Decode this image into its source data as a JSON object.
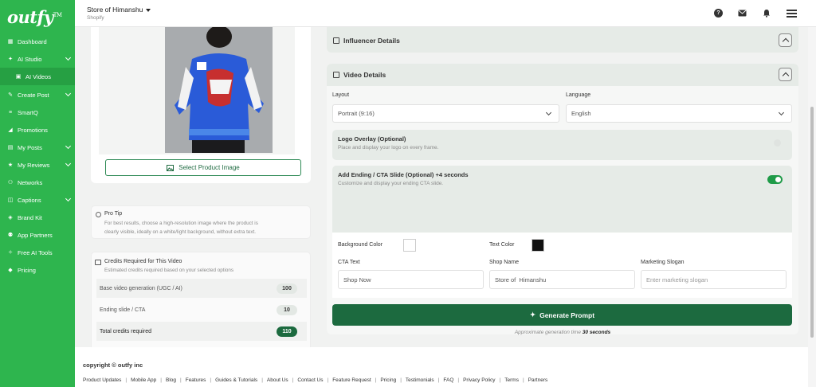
{
  "brand": {
    "name": "outfy",
    "mark": "TM"
  },
  "sidebar": {
    "items": [
      {
        "label": "Dashboard",
        "icon": "dashboard-icon",
        "chevron": false
      },
      {
        "label": "AI Studio",
        "icon": "ai-studio-icon",
        "chevron": true
      },
      {
        "label": "AI Videos",
        "icon": "video-icon",
        "chevron": false
      },
      {
        "label": "Create Post",
        "icon": "pencil-icon",
        "chevron": true
      },
      {
        "label": "SmartQ",
        "icon": "queue-icon",
        "chevron": false
      },
      {
        "label": "Promotions",
        "icon": "megaphone-icon",
        "chevron": false
      },
      {
        "label": "My Posts",
        "icon": "posts-icon",
        "chevron": true
      },
      {
        "label": "My Reviews",
        "icon": "star-icon",
        "chevron": true
      },
      {
        "label": "Networks",
        "icon": "network-icon",
        "chevron": false
      },
      {
        "label": "Captions",
        "icon": "captions-icon",
        "chevron": true
      },
      {
        "label": "Brand Kit",
        "icon": "brand-kit-icon",
        "chevron": false
      },
      {
        "label": "App Partners",
        "icon": "partners-icon",
        "chevron": false
      },
      {
        "label": "Free AI Tools",
        "icon": "tools-icon",
        "chevron": false
      },
      {
        "label": "Pricing",
        "icon": "tag-icon",
        "chevron": false
      }
    ]
  },
  "header": {
    "store": "Store of Himanshu",
    "platform": "Shopify"
  },
  "product": {
    "select_label": "Select Product Image"
  },
  "protip": {
    "title": "Pro Tip",
    "line1": "For best results, choose a high-resolution image where the product is",
    "line2": "clearly visible, ideally on a white/light background, without extra text."
  },
  "credits": {
    "title": "Credits Required for This Video",
    "subtitle": "Estimated credits required based on your selected options",
    "rows": [
      {
        "label": "Base video generation (UGC / AI)",
        "value": "100"
      },
      {
        "label": "Ending slide / CTA",
        "value": "10"
      },
      {
        "label": "Total credits required",
        "value": "110"
      }
    ]
  },
  "influencer": {
    "title": "Influencer Details"
  },
  "video": {
    "title": "Video Details",
    "layout_label": "Layout",
    "layout_value": "Portrait (9:16)",
    "language_label": "Language",
    "language_value": "English",
    "logo_title": "Logo Overlay (Optional)",
    "logo_desc": "Place and display your logo on every frame.",
    "cta_title": "Add Ending / CTA Slide (Optional) +4 seconds",
    "cta_desc": "Customize and display your ending CTA slide.",
    "bg_color_label": "Background Color",
    "text_color_label": "Text Color",
    "bg_color": "#ffffff",
    "text_color": "#111111",
    "cta_text_label": "CTA Text",
    "cta_text_value": "Shop Now",
    "shop_name_label": "Shop Name",
    "shop_name_value": "Store of  Himanshu",
    "slogan_label": "Marketing Slogan",
    "slogan_placeholder": "Enter marketing slogan",
    "generate_label": "Generate Prompt",
    "gen_time_prefix": "Approximate generation time",
    "gen_time_value": "30 seconds"
  },
  "footer": {
    "copyright": "copyright © outfy inc",
    "links": [
      "Product Updates",
      "Mobile App",
      "Blog",
      "Features",
      "Guides & Tutorials",
      "About Us",
      "Contact Us",
      "Feature Request",
      "Pricing",
      "Testimonials",
      "FAQ",
      "Privacy Policy",
      "Terms",
      "Partners"
    ]
  },
  "colors": {
    "sidebar": "#2eb54e",
    "primary": "#1c6a3f",
    "toggle_on": "#1f9b48"
  }
}
